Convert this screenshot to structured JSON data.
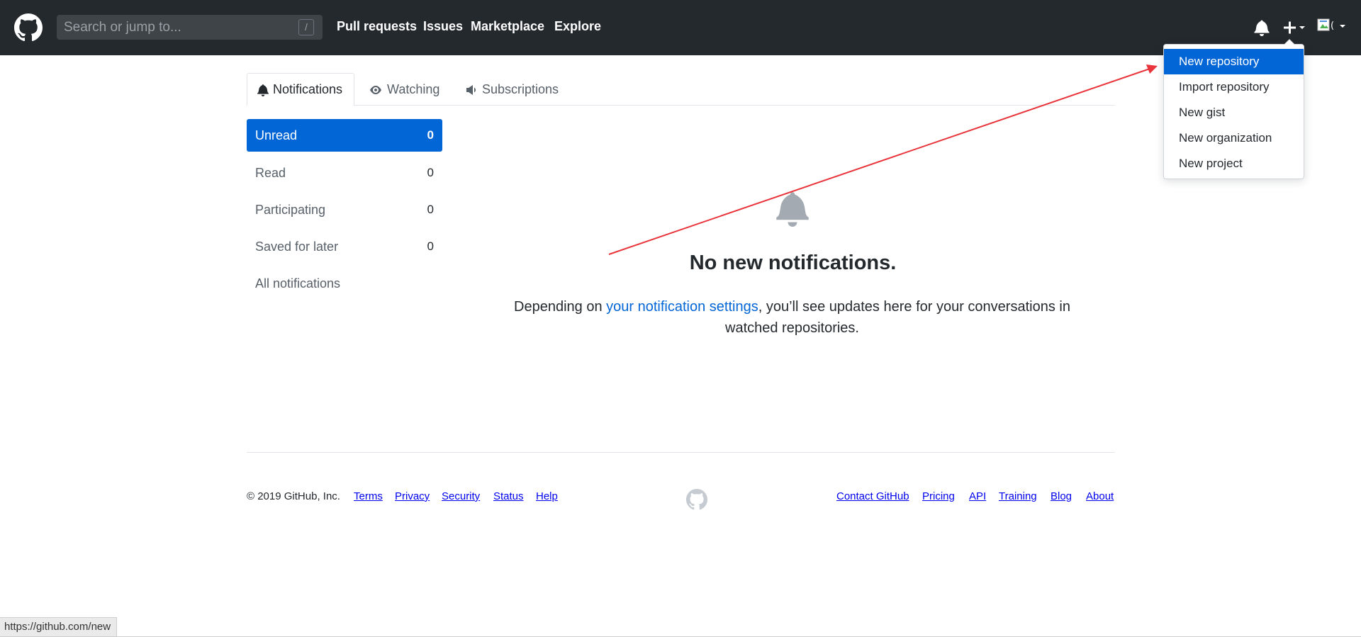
{
  "header": {
    "search_placeholder": "Search or jump to...",
    "search_shortcut": "/",
    "nav": [
      "Pull requests",
      "Issues",
      "Marketplace",
      "Explore"
    ],
    "icons": {
      "logo": "github-logo-icon",
      "notifications": "bell-icon",
      "create": "plus-icon",
      "avatar": "avatar-broken-image-icon"
    }
  },
  "create_menu": {
    "items": [
      "New repository",
      "Import repository",
      "New gist",
      "New organization",
      "New project"
    ],
    "highlighted": "New repository"
  },
  "tabs": [
    {
      "label": "Notifications",
      "icon": "bell-icon",
      "selected": true
    },
    {
      "label": "Watching",
      "icon": "eye-icon",
      "selected": false
    },
    {
      "label": "Subscriptions",
      "icon": "megaphone-icon",
      "selected": false
    }
  ],
  "filters": [
    {
      "label": "Unread",
      "count": "0",
      "active": true
    },
    {
      "label": "Read",
      "count": "0",
      "active": false
    },
    {
      "label": "Participating",
      "count": "0",
      "active": false
    },
    {
      "label": "Saved for later",
      "count": "0",
      "active": false
    },
    {
      "label": "All notifications",
      "count": "",
      "active": false
    }
  ],
  "blankslate": {
    "title": "No new notifications.",
    "desc_before": "Depending on ",
    "desc_link": "your notification settings",
    "desc_after": ", you’ll see updates here for your conversations in watched repositories."
  },
  "footer": {
    "copyright": "© 2019 GitHub, Inc.",
    "left_links": [
      "Terms",
      "Privacy",
      "Security",
      "Status",
      "Help"
    ],
    "right_links": [
      "Contact GitHub",
      "Pricing",
      "API",
      "Training",
      "Blog",
      "About"
    ]
  },
  "status_url": "https://github.com/new",
  "colors": {
    "header_bg": "#24292e",
    "accent": "#0366d6",
    "annotation_arrow": "#e8343a"
  }
}
